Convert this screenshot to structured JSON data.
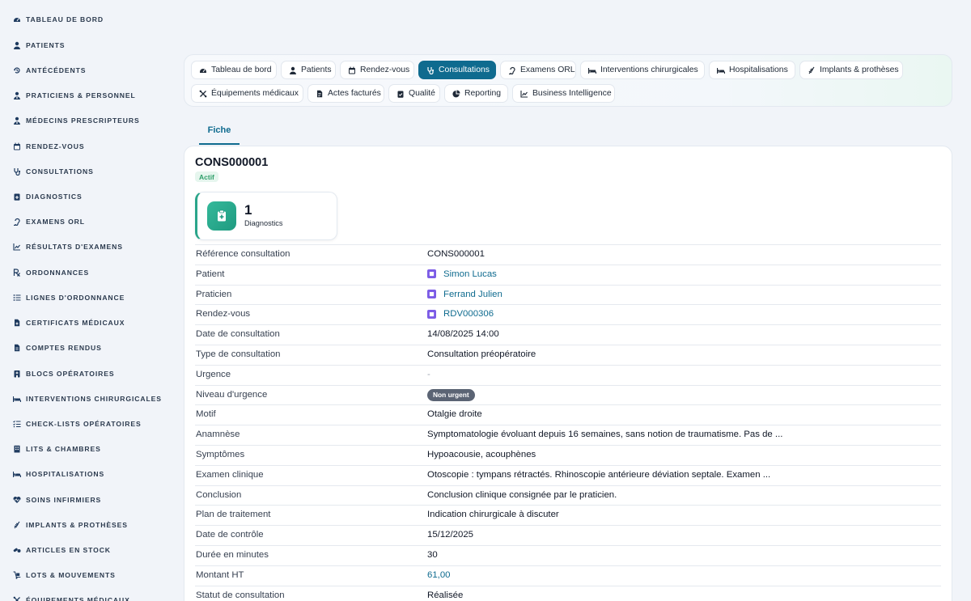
{
  "sidebar": {
    "items": [
      {
        "label": "TABLEAU DE BORD",
        "icon": "dashboard-icon"
      },
      {
        "label": "PATIENTS",
        "icon": "user-icon"
      },
      {
        "label": "ANTÉCÉDENTS",
        "icon": "history-icon"
      },
      {
        "label": "PRATICIENS & PERSONNEL",
        "icon": "user-doctor-icon"
      },
      {
        "label": "MÉDECINS PRESCRIPTEURS",
        "icon": "user-doctor-icon"
      },
      {
        "label": "RENDEZ-VOUS",
        "icon": "calendar-icon"
      },
      {
        "label": "CONSULTATIONS",
        "icon": "stethoscope-icon"
      },
      {
        "label": "DIAGNOSTICS",
        "icon": "clipboard-medical-icon"
      },
      {
        "label": "EXAMENS ORL",
        "icon": "ear-icon"
      },
      {
        "label": "RÉSULTATS D'EXAMENS",
        "icon": "chart-line-icon"
      },
      {
        "label": "ORDONNANCES",
        "icon": "prescription-icon"
      },
      {
        "label": "LIGNES D'ORDONNANCE",
        "icon": "list-icon"
      },
      {
        "label": "CERTIFICATS MÉDICAUX",
        "icon": "file-medical-icon"
      },
      {
        "label": "COMPTES RENDUS",
        "icon": "file-text-icon"
      },
      {
        "label": "BLOCS OPÉRATOIRES",
        "icon": "hospital-icon"
      },
      {
        "label": "INTERVENTIONS CHIRURGICALES",
        "icon": "bed-pulse-icon"
      },
      {
        "label": "CHECK-LISTS OPÉRATOIRES",
        "icon": "list-check-icon"
      },
      {
        "label": "LITS & CHAMBRES",
        "icon": "building-icon"
      },
      {
        "label": "HOSPITALISATIONS",
        "icon": "bed-icon"
      },
      {
        "label": "SOINS INFIRMIERS",
        "icon": "heart-pulse-icon"
      },
      {
        "label": "IMPLANTS & PROTHÈSES",
        "icon": "implant-icon"
      },
      {
        "label": "ARTICLES EN STOCK",
        "icon": "pills-icon"
      },
      {
        "label": "LOTS & MOUVEMENTS",
        "icon": "dolly-icon"
      },
      {
        "label": "ÉQUIPEMENTS MÉDICAUX",
        "icon": "tools-icon"
      }
    ]
  },
  "tabs": [
    {
      "label": "Tableau de bord",
      "icon": "dashboard-icon"
    },
    {
      "label": "Patients",
      "icon": "user-icon"
    },
    {
      "label": "Rendez-vous",
      "icon": "calendar-icon"
    },
    {
      "label": "Consultations",
      "icon": "stethoscope-icon",
      "active": true
    },
    {
      "label": "Examens ORL",
      "icon": "ear-icon"
    },
    {
      "label": "Interventions chirurgicales",
      "icon": "bed-pulse-icon"
    },
    {
      "label": "Hospitalisations",
      "icon": "bed-icon"
    },
    {
      "label": "Implants & prothèses",
      "icon": "implant-icon"
    },
    {
      "label": "Équipements médicaux",
      "icon": "tools-icon"
    },
    {
      "label": "Actes facturés",
      "icon": "file-invoice-icon"
    },
    {
      "label": "Qualité",
      "icon": "clipboard-check-icon"
    },
    {
      "label": "Reporting",
      "icon": "chart-pie-icon"
    },
    {
      "label": "Business Intelligence",
      "icon": "chart-line-icon"
    }
  ],
  "subtab": {
    "label": "Fiche"
  },
  "record": {
    "title": "CONS000001",
    "status": "Actif",
    "stat": {
      "value": "1",
      "label": "Diagnostics",
      "icon": "clipboard-medical-icon"
    }
  },
  "fields": [
    {
      "key": "Référence consultation",
      "value": "CONS000001"
    },
    {
      "key": "Patient",
      "value": "Simon Lucas",
      "type": "link"
    },
    {
      "key": "Praticien",
      "value": "Ferrand Julien",
      "type": "link"
    },
    {
      "key": "Rendez-vous",
      "value": "RDV000306",
      "type": "link"
    },
    {
      "key": "Date de consultation",
      "value": "14/08/2025 14:00"
    },
    {
      "key": "Type de consultation",
      "value": "Consultation préopératoire"
    },
    {
      "key": "Urgence",
      "value": "-",
      "type": "muted"
    },
    {
      "key": "Niveau d'urgence",
      "value": "Non urgent",
      "type": "pill"
    },
    {
      "key": "Motif",
      "value": "Otalgie droite"
    },
    {
      "key": "Anamnèse",
      "value": "Symptomatologie évoluant depuis 16 semaines, sans notion de traumatisme. Pas de ..."
    },
    {
      "key": "Symptômes",
      "value": "Hypoacousie, acouphènes"
    },
    {
      "key": "Examen clinique",
      "value": "Otoscopie : tympans rétractés. Rhinoscopie antérieure déviation septale. Examen ..."
    },
    {
      "key": "Conclusion",
      "value": "Conclusion clinique consignée par le praticien."
    },
    {
      "key": "Plan de traitement",
      "value": "Indication chirurgicale à discuter"
    },
    {
      "key": "Date de contrôle",
      "value": "15/12/2025"
    },
    {
      "key": "Durée en minutes",
      "value": "30"
    },
    {
      "key": "Montant HT",
      "value": "61,00",
      "type": "money"
    },
    {
      "key": "Statut de consultation",
      "value": "Réalisée"
    }
  ]
}
